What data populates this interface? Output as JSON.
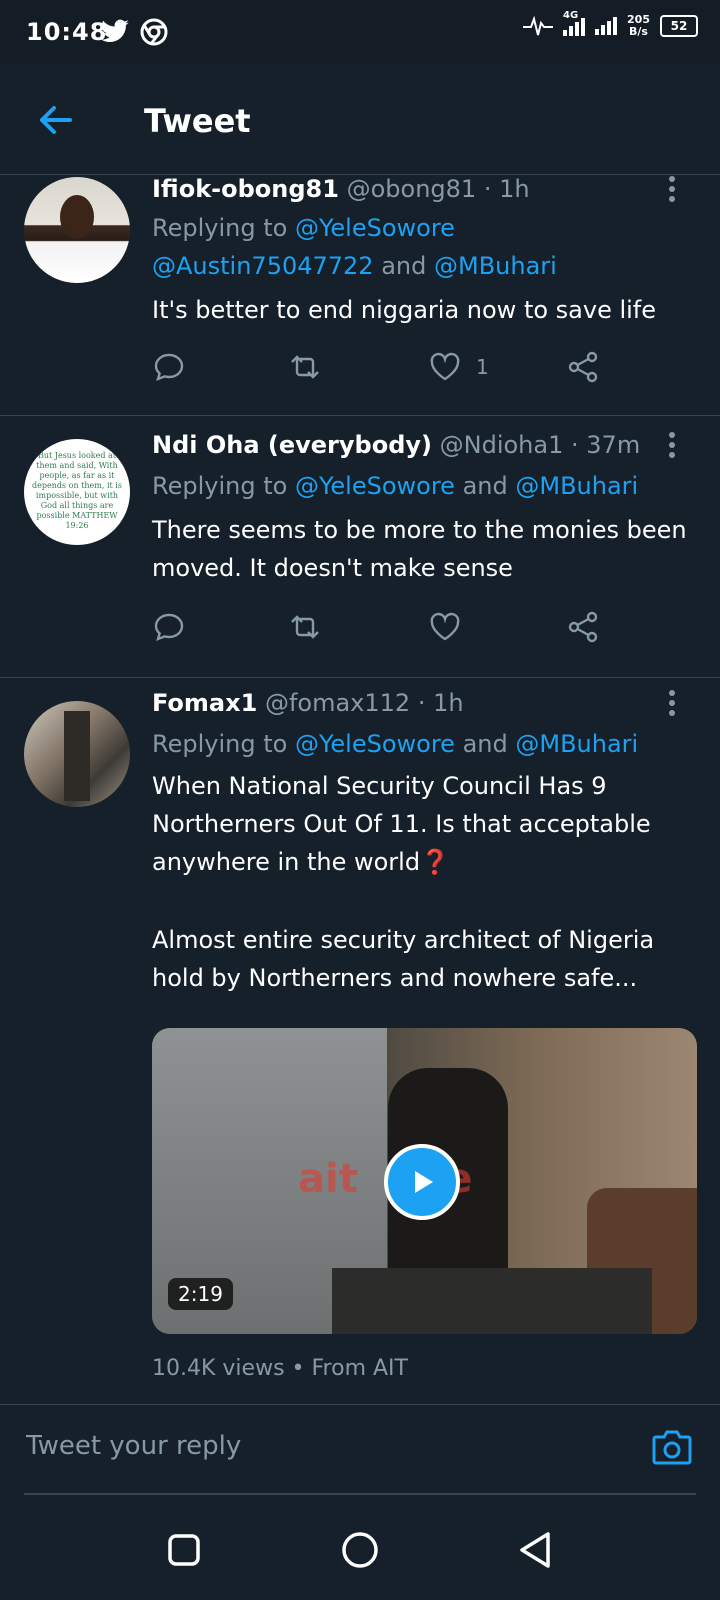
{
  "status_bar": {
    "time": "10:48",
    "network": "4G",
    "net_speed_value": "205",
    "net_speed_unit": "B/s",
    "battery": "52"
  },
  "header": {
    "title": "Tweet"
  },
  "tweets": [
    {
      "name": "Ifiok-obong81",
      "handle": "@obong81",
      "time": "1h",
      "replying_prefix": "Replying to ",
      "mentions": [
        "@YeleSowore",
        "@Austin75047722",
        "@MBuhari"
      ],
      "joiner": " and ",
      "text": "It's better to end niggaria now to save life",
      "likes": "1"
    },
    {
      "name": "Ndi Oha (everybody)",
      "handle": "@Ndioha1",
      "time": "37m",
      "replying_prefix": "Replying to ",
      "mentions": [
        "@YeleSowore",
        "@MBuhari"
      ],
      "joiner": " and ",
      "text": "There seems to be  more to the monies been moved. It doesn't make sense",
      "likes": "",
      "avatar_text": "But Jesus looked at them and said, With people, as far as it depends on them, it is impossible, but with God all things are possible MATTHEW 19:26"
    },
    {
      "name": "Fomax1",
      "handle": "@fomax112",
      "time": "1h",
      "replying_prefix": "Replying to ",
      "mentions": [
        "@YeleSowore",
        "@MBuhari"
      ],
      "joiner": " and ",
      "text_line1": "When National Security Council Has 9 Northerners Out Of 11. Is that acceptable anywhere in the world",
      "text_emoji": "❓",
      "text_line2": "Almost entire security architect of Nigeria hold by Northerners and nowhere safe...",
      "video_duration": "2:19",
      "video_watermark": "ait",
      "video_watermark_suffix": "live",
      "views": "10.4K views",
      "views_sep": " • ",
      "source": "From AIT"
    }
  ],
  "reply_bar": {
    "placeholder": "Tweet your reply"
  },
  "colors": {
    "accent": "#1da1f2",
    "background": "#15202b",
    "muted": "#8899a6",
    "divider": "#38444d"
  }
}
